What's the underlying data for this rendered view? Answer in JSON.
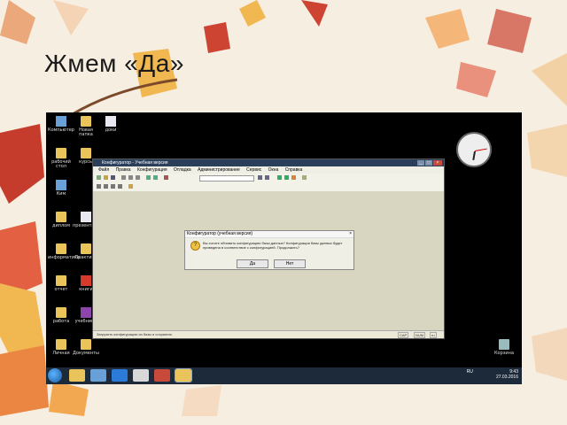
{
  "slide": {
    "title": "Жмем «Да»"
  },
  "desktop": {
    "icons": [
      {
        "label": "Компьютер",
        "kind": "computer"
      },
      {
        "label": "Новая папка",
        "kind": "folder"
      },
      {
        "label": "доки",
        "kind": "doc"
      },
      {
        "label": "рабочий стол",
        "kind": "folder"
      },
      {
        "label": "курсы",
        "kind": "folder"
      },
      {
        "label": "ЕГЭ",
        "kind": "doc"
      },
      {
        "label": "Ким",
        "kind": "computer"
      },
      {
        "label": "диплом",
        "kind": "folder"
      },
      {
        "label": "презентация",
        "kind": "doc"
      },
      {
        "label": "информатика",
        "kind": "folder"
      },
      {
        "label": "Практика",
        "kind": "folder"
      },
      {
        "label": "отчет",
        "kind": "folder"
      },
      {
        "label": "книги",
        "kind": "pdf"
      },
      {
        "label": "работа",
        "kind": "folder"
      },
      {
        "label": "учебники",
        "kind": "books"
      },
      {
        "label": "Личная",
        "kind": "folder"
      },
      {
        "label": "Документы",
        "kind": "folder"
      },
      {
        "label": "Корзина",
        "kind": "trash"
      }
    ]
  },
  "app": {
    "title": "Конфигуратор - Учебная версия",
    "menu": [
      "Файл",
      "Правка",
      "Конфигурация",
      "Отладка",
      "Администрирование",
      "Сервис",
      "Окна",
      "Справка"
    ],
    "status_text": "Загрузить конфигурацию из базы и сохранить",
    "status_cells": [
      "CAP",
      "NUM",
      "ru"
    ]
  },
  "dialog": {
    "title": "Конфигуратор (учебная версия)",
    "close": "×",
    "icon": "?",
    "message": "Вы хотите обновить конфигурацию базы данных? Конфигурация базы данных будет приведена в соответствие с конфигурацией. Продолжить?",
    "yes_label": "Да",
    "no_label": "Нет"
  },
  "taskbar": {
    "lang": "RU",
    "time": "9:43",
    "date": "27.03.2016"
  }
}
